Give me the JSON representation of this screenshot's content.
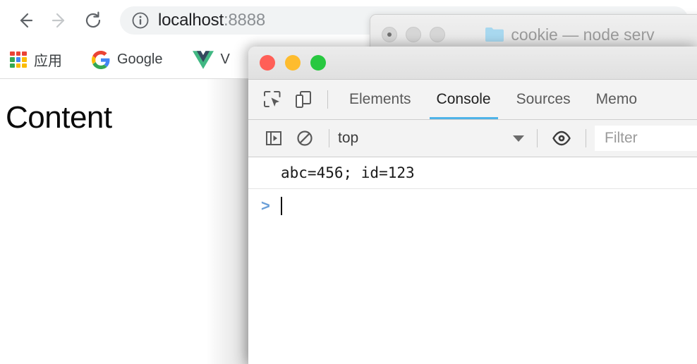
{
  "browser": {
    "nav": {
      "back_label": "Back",
      "forward_label": "Forward",
      "reload_label": "Reload"
    },
    "omnibox": {
      "info_icon": "info-circle-icon",
      "url_host": "localhost",
      "url_port": ":8888"
    },
    "bookmarks": [
      {
        "icon": "apps-grid-icon",
        "label": "应用"
      },
      {
        "icon": "google-g-icon",
        "label": "Google"
      },
      {
        "icon": "vue-logo-icon",
        "label": "V"
      }
    ],
    "page": {
      "heading": "Content"
    }
  },
  "terminal_window": {
    "title": "cookie — node serv",
    "folder_icon": "folder-icon",
    "traffic_lights": [
      "inactive-close",
      "inactive-minimize",
      "inactive-zoom"
    ]
  },
  "devtools": {
    "traffic_lights": {
      "close": "#ff5f57",
      "minimize": "#febc2e",
      "zoom": "#28c840"
    },
    "toolbar_icons": [
      {
        "name": "inspect-element-icon"
      },
      {
        "name": "device-toolbar-icon"
      }
    ],
    "tabs": [
      {
        "label": "Elements",
        "active": false
      },
      {
        "label": "Console",
        "active": true
      },
      {
        "label": "Sources",
        "active": false
      },
      {
        "label": "Memo",
        "active": false
      }
    ],
    "active_tab_underline": "#4fb3e8",
    "console_toolbar": {
      "sidebar_toggle_icon": "console-sidebar-icon",
      "clear_icon": "clear-console-icon",
      "context": "top",
      "context_caret": "chevron-down-icon",
      "eye_icon": "live-expression-eye-icon",
      "filter_placeholder": "Filter"
    },
    "console": {
      "messages": [
        {
          "text": "abc=456; id=123"
        }
      ],
      "prompt_symbol": ">"
    }
  }
}
